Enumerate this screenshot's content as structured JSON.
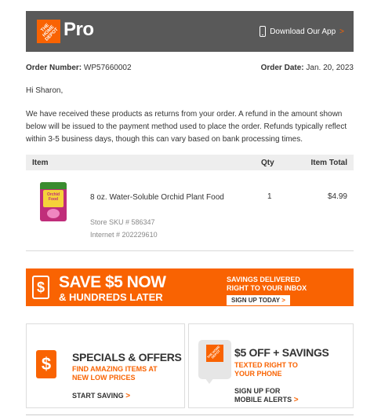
{
  "header": {
    "logo_text": "THE HOME DEPOT",
    "brand_suffix": "Pro",
    "app_link": "Download Our App",
    "chevron": ">"
  },
  "order": {
    "number_label": "Order Number:",
    "number_value": "WP57660002",
    "date_label": "Order Date:",
    "date_value": "Jan. 20, 2023"
  },
  "greeting": "Hi Sharon,",
  "message": "We have received these products as returns from your order. A refund in the amount shown below will be issued to the payment method used to place the order. Refunds typically reflect within 3-5 business days, though this can vary based on bank processing times.",
  "table": {
    "headers": {
      "item": "Item",
      "qty": "Qty",
      "total": "Item Total"
    },
    "items": [
      {
        "name": "8 oz. Water-Soluble Orchid Plant Food",
        "qty": "1",
        "total": "$4.99",
        "sku": "Store SKU # 586347",
        "internet": "Internet # 202229610",
        "image_label": "Orchid Food"
      }
    ]
  },
  "banner": {
    "dollar": "$",
    "headline": "SAVE $5 NOW",
    "subline": "& HUNDREDS LATER",
    "right_line1": "SAVINGS DELIVERED",
    "right_line2": "RIGHT TO YOUR INBOX",
    "cta": "SIGN UP TODAY",
    "cta_chevron": ">"
  },
  "promo_left": {
    "dollar": "$",
    "title": "SPECIALS & OFFERS",
    "sub_line1": "FIND AMAZING ITEMS AT",
    "sub_line2": "NEW LOW PRICES",
    "cta": "START SAVING",
    "cta_chevron": ">"
  },
  "promo_right": {
    "logo_text": "THE HOME DEPOT",
    "title": "$5 OFF + SAVINGS",
    "sub_line1": "TEXTED RIGHT TO",
    "sub_line2": "YOUR PHONE",
    "cta_line1": "SIGN UP FOR",
    "cta_line2": "MOBILE ALERTS",
    "cta_chevron": ">"
  },
  "colors": {
    "brand_orange": "#f96302",
    "header_gray": "#595959",
    "table_header_bg": "#eeeeee"
  }
}
